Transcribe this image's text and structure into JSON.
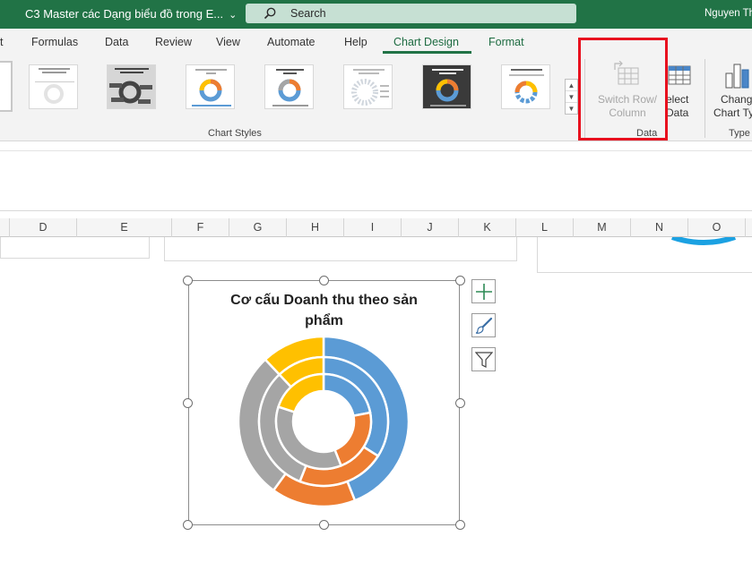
{
  "window": {
    "doc_title": "C3 Master các Dạng biểu đồ trong E...",
    "search_placeholder": "Search",
    "user_name": "Nguyen Th"
  },
  "tabs": [
    {
      "label": "t"
    },
    {
      "label": "Formulas"
    },
    {
      "label": "Data"
    },
    {
      "label": "Review"
    },
    {
      "label": "View"
    },
    {
      "label": "Automate"
    },
    {
      "label": "Help"
    },
    {
      "label": "Chart Design",
      "active": true
    },
    {
      "label": "Format"
    }
  ],
  "ribbon": {
    "chart_styles": {
      "group_label": "Chart Styles",
      "thumbnails": [
        {
          "title": "CƠ CẤU DOANH THU THEO SẢN PHẨM"
        },
        {
          "title": "Cơ cấu Doanh thu theo sản phẩm"
        },
        {
          "title": "Cơ cấu Doanh thu theo sản phẩm"
        },
        {
          "title": "Cơ cấu Doanh thu theo sản phẩm"
        },
        {
          "title": "Cơ cấu Doanh thu theo sản phẩm"
        },
        {
          "title": "Cơ cấu Doanh thu theo sản phẩm"
        },
        {
          "title": "CƠ CẤU DOANH THU THEO SẢN PHẨM"
        }
      ]
    },
    "data_group": {
      "group_label": "Data",
      "switch_row_column": {
        "line1": "Switch Row/",
        "line2": "Column"
      },
      "select_data": {
        "line1": "elect",
        "line2": "Data"
      }
    },
    "type_group": {
      "group_label": "Type",
      "change_chart_type": {
        "line1": "Chang",
        "line2": "Chart Ty"
      }
    }
  },
  "columns": [
    "D",
    "E",
    "F",
    "G",
    "H",
    "I",
    "J",
    "K",
    "L",
    "M",
    "N",
    "O"
  ],
  "chart": {
    "title_line1": "Cơ cấu Doanh thu theo sản",
    "title_line2": "phẩm",
    "colors": {
      "blue": "#5b9bd5",
      "orange": "#ed7d31",
      "gray": "#a5a5a5",
      "yellow": "#ffc000"
    },
    "chart_data": {
      "type": "doughnut",
      "title": "Cơ cấu Doanh thu theo sản phẩm",
      "series": [
        {
          "values": [
            44,
            16,
            28,
            12
          ]
        },
        {
          "values": [
            34,
            22,
            32,
            12
          ]
        },
        {
          "values": [
            22,
            22,
            36,
            20
          ]
        }
      ]
    }
  },
  "chart_side_buttons": [
    {
      "icon": "plus-icon"
    },
    {
      "icon": "paintbrush-icon"
    },
    {
      "icon": "filter-icon"
    }
  ]
}
